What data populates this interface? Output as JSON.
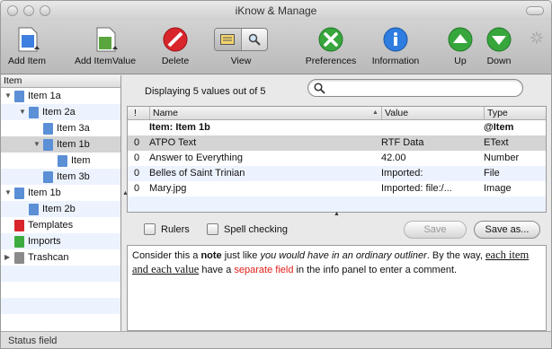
{
  "window": {
    "title": "iKnow & Manage"
  },
  "toolbar": {
    "add_item": "Add Item",
    "add_item_value": "Add ItemValue",
    "delete": "Delete",
    "view": "View",
    "preferences": "Preferences",
    "information": "Information",
    "up": "Up",
    "down": "Down"
  },
  "tree": {
    "header": "Item",
    "items": [
      {
        "label": "Item 1a",
        "expanded": true,
        "color": "#5b8fd6"
      },
      {
        "label": "Item 2a",
        "expanded": true,
        "color": "#5b8fd6"
      },
      {
        "label": "Item 3a",
        "expanded": false,
        "color": "#5b8fd6"
      },
      {
        "label": "Item 1b",
        "expanded": true,
        "color": "#5b8fd6"
      },
      {
        "label": "Item",
        "expanded": false,
        "color": "#5b8fd6"
      },
      {
        "label": "Item 3b",
        "expanded": false,
        "color": "#5b8fd6"
      },
      {
        "label": "Item 1b",
        "expanded": true,
        "color": "#5b8fd6"
      },
      {
        "label": "Item 2b",
        "expanded": false,
        "color": "#5b8fd6"
      },
      {
        "label": "Templates",
        "expanded": false,
        "color": "#d9262b"
      },
      {
        "label": "Imports",
        "expanded": false,
        "color": "#3dab3f"
      },
      {
        "label": "Trashcan",
        "expanded": false,
        "color": "#8a8a8a"
      }
    ]
  },
  "main": {
    "display_text": "Displaying 5 values out of 5",
    "search": {
      "value": "",
      "placeholder": ""
    },
    "columns": {
      "bang": "!",
      "name": "Name",
      "value": "Value",
      "type": "Type"
    },
    "rows": [
      {
        "bang": "",
        "name": "Item: Item 1b",
        "value": "",
        "type": "@Item",
        "bold": true
      },
      {
        "bang": "0",
        "name": "ATPO Text",
        "value": "RTF Data",
        "type": "EText"
      },
      {
        "bang": "0",
        "name": "Answer to Everything",
        "value": "42.00",
        "type": "Number"
      },
      {
        "bang": "0",
        "name": "Belles of Saint Trinian",
        "value": "Imported:",
        "type": "File"
      },
      {
        "bang": "0",
        "name": "Mary.jpg",
        "value": "Imported: file:/...",
        "type": "Image"
      }
    ],
    "rulers_label": "Rulers",
    "spell_label": "Spell checking",
    "save_label": "Save",
    "save_as_label": "Save as...",
    "note": {
      "p1": "Consider this a ",
      "bold": "note",
      "p2": " just like ",
      "italic": "you would have in an ordinary outliner",
      "p3": ". By the way, ",
      "serif": "each item and each value",
      "p4": " have a ",
      "red": "separate field",
      "p5": " in the info panel to enter a comment."
    }
  },
  "status": {
    "text": "Status field"
  }
}
